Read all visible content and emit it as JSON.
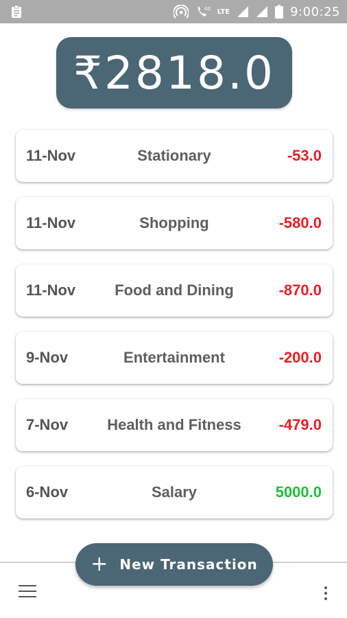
{
  "status_bar": {
    "time": "9:00:25",
    "network": "LTE",
    "icons": [
      "clipboard-icon",
      "hotspot-icon",
      "wifi-calling-icon",
      "signal-icon",
      "battery-icon"
    ]
  },
  "balance": {
    "amount": "₹2818.0"
  },
  "transactions": [
    {
      "date": "11-Nov",
      "category": "Stationary",
      "amount": "-53.0",
      "type": "expense"
    },
    {
      "date": "11-Nov",
      "category": "Shopping",
      "amount": "-580.0",
      "type": "expense"
    },
    {
      "date": "11-Nov",
      "category": "Food and Dining",
      "amount": "-870.0",
      "type": "expense"
    },
    {
      "date": "9-Nov",
      "category": "Entertainment",
      "amount": "-200.0",
      "type": "expense"
    },
    {
      "date": "7-Nov",
      "category": "Health and Fitness",
      "amount": "-479.0",
      "type": "expense"
    },
    {
      "date": "6-Nov",
      "category": "Salary",
      "amount": "5000.0",
      "type": "income"
    }
  ],
  "fab": {
    "icon": "plus-icon",
    "label": "New Transaction"
  },
  "bottom_bar": {
    "left_icon": "menu-icon",
    "right_icon": "more-vert-icon"
  },
  "colors": {
    "accent": "#4b6674",
    "expense": "#ee1c24",
    "income": "#1ec038",
    "status_bar": "#ababab"
  }
}
